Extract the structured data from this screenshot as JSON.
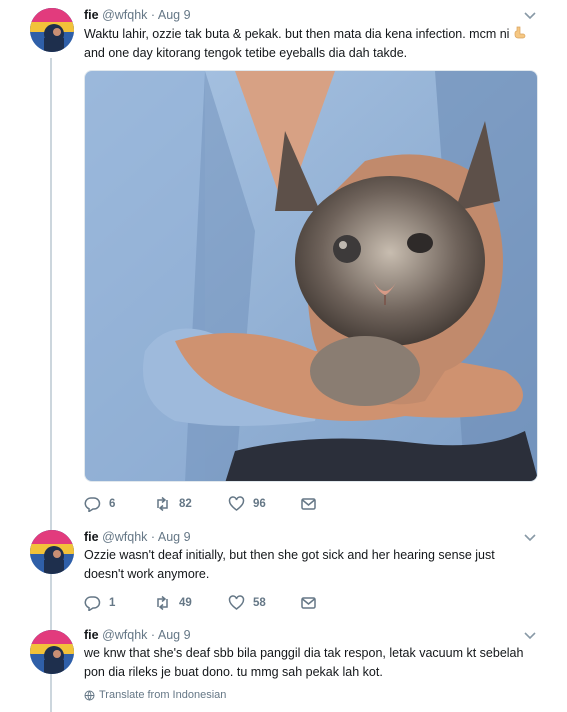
{
  "tweets": [
    {
      "name": "fie",
      "handle": "@wfqhk",
      "separator": "·",
      "date": "Aug 9",
      "text_line1": "Waktu lahir, ozzie tak buta & pekak. but then mata dia kena infection. mcm ni",
      "text_line2": "and one day kitorang tengok tetibe eyeballs dia dah takde.",
      "emoji": "pointing-down-hand",
      "replies": "6",
      "retweets": "82",
      "likes": "96"
    },
    {
      "name": "fie",
      "handle": "@wfqhk",
      "separator": "·",
      "date": "Aug 9",
      "text_line1": "Ozzie wasn't deaf initially, but then she got sick and her hearing sense just",
      "text_line2": "doesn't work anymore.",
      "replies": "1",
      "retweets": "49",
      "likes": "58"
    },
    {
      "name": "fie",
      "handle": "@wfqhk",
      "separator": "·",
      "date": "Aug 9",
      "text_line1": "we knw that she's deaf sbb bila panggil dia tak respon, letak vacuum kt sebelah",
      "text_line2": "pon dia rileks je buat dono. tu mmg sah pekak lah kot.",
      "translate": "Translate from Indonesian"
    }
  ],
  "colors": {
    "text": "#14171a",
    "muted": "#657786",
    "thread": "#ccd6dd"
  },
  "icons": [
    "reply-icon",
    "retweet-icon",
    "like-icon",
    "dm-icon",
    "chevron-down-icon",
    "globe-icon"
  ]
}
